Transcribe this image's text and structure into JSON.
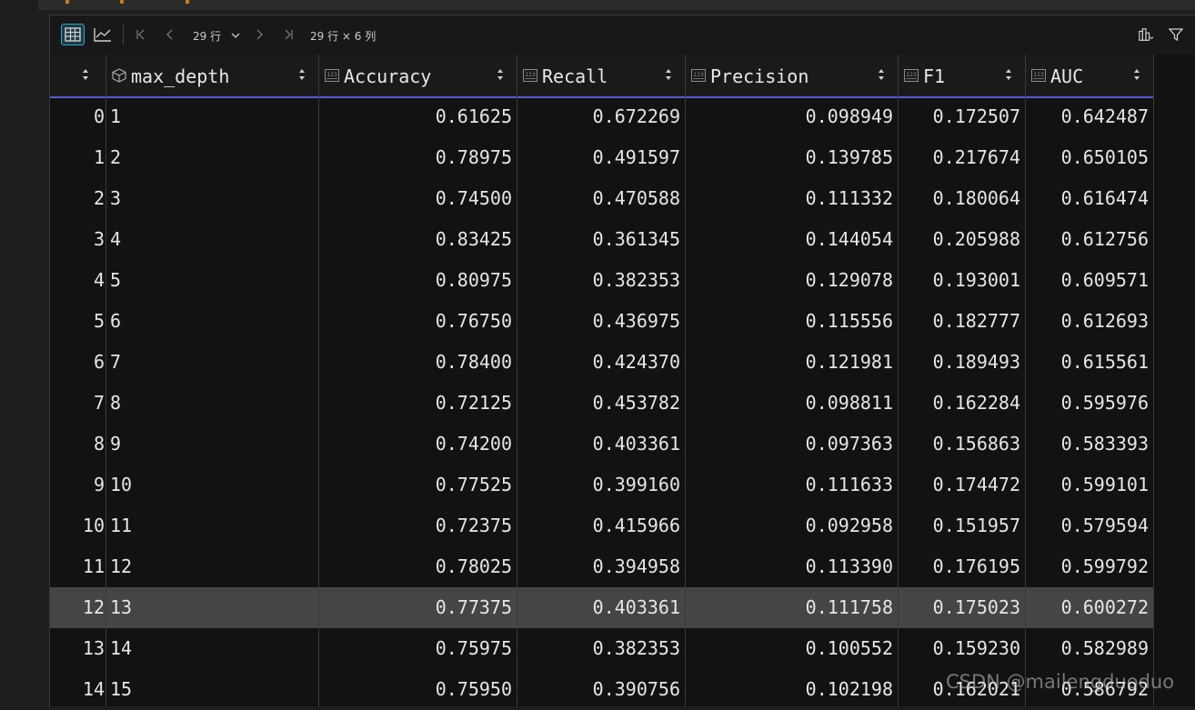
{
  "toolbar": {
    "row_select_value": "29 行",
    "dims_text": "29 行 × 6 列"
  },
  "columns": [
    {
      "name": "",
      "type": "index"
    },
    {
      "name": "max_depth",
      "type": "object"
    },
    {
      "name": "Accuracy",
      "type": "numeric"
    },
    {
      "name": "Recall",
      "type": "numeric"
    },
    {
      "name": "Precision",
      "type": "numeric"
    },
    {
      "name": "F1",
      "type": "numeric"
    },
    {
      "name": "AUC",
      "type": "numeric"
    }
  ],
  "rows": [
    [
      "0",
      "1",
      "0.61625",
      "0.672269",
      "0.098949",
      "0.172507",
      "0.642487"
    ],
    [
      "1",
      "2",
      "0.78975",
      "0.491597",
      "0.139785",
      "0.217674",
      "0.650105"
    ],
    [
      "2",
      "3",
      "0.74500",
      "0.470588",
      "0.111332",
      "0.180064",
      "0.616474"
    ],
    [
      "3",
      "4",
      "0.83425",
      "0.361345",
      "0.144054",
      "0.205988",
      "0.612756"
    ],
    [
      "4",
      "5",
      "0.80975",
      "0.382353",
      "0.129078",
      "0.193001",
      "0.609571"
    ],
    [
      "5",
      "6",
      "0.76750",
      "0.436975",
      "0.115556",
      "0.182777",
      "0.612693"
    ],
    [
      "6",
      "7",
      "0.78400",
      "0.424370",
      "0.121981",
      "0.189493",
      "0.615561"
    ],
    [
      "7",
      "8",
      "0.72125",
      "0.453782",
      "0.098811",
      "0.162284",
      "0.595976"
    ],
    [
      "8",
      "9",
      "0.74200",
      "0.403361",
      "0.097363",
      "0.156863",
      "0.583393"
    ],
    [
      "9",
      "10",
      "0.77525",
      "0.399160",
      "0.111633",
      "0.174472",
      "0.599101"
    ],
    [
      "10",
      "11",
      "0.72375",
      "0.415966",
      "0.092958",
      "0.151957",
      "0.579594"
    ],
    [
      "11",
      "12",
      "0.78025",
      "0.394958",
      "0.113390",
      "0.176195",
      "0.599792"
    ],
    [
      "12",
      "13",
      "0.77375",
      "0.403361",
      "0.111758",
      "0.175023",
      "0.600272"
    ],
    [
      "13",
      "14",
      "0.75975",
      "0.382353",
      "0.100552",
      "0.159230",
      "0.582989"
    ],
    [
      "14",
      "15",
      "0.75950",
      "0.390756",
      "0.102198",
      "0.162021",
      "0.586792"
    ]
  ],
  "selected_row": 12,
  "watermark": "CSDN @mailengduoduo",
  "colors": {
    "background": "#121212",
    "header_underline": "#5a5ad8",
    "selected_row": "#454545",
    "active_button": "#2ea8c8"
  },
  "icons": {
    "table_view": "table-icon",
    "chart_view": "line-chart-icon",
    "first": "first-page-icon",
    "prev": "chevron-left-icon",
    "next": "chevron-right-icon",
    "last": "last-page-icon",
    "columns": "columns-icon",
    "filter": "filter-icon"
  }
}
